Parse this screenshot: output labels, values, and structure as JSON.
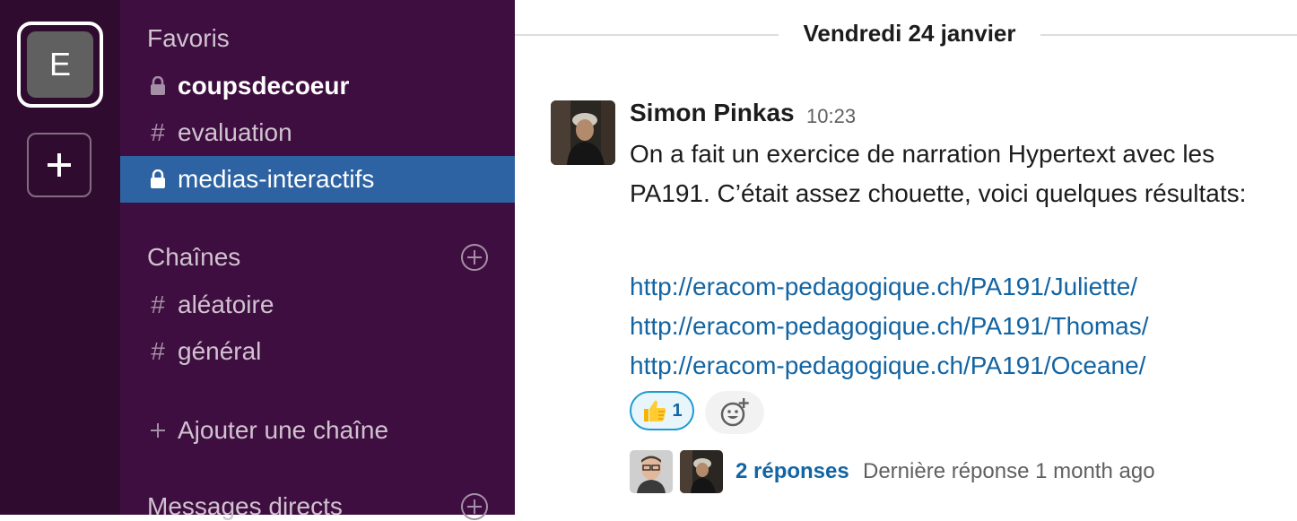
{
  "workspace": {
    "initial": "E"
  },
  "sidebar": {
    "favorites": {
      "title": "Favoris",
      "channels": [
        {
          "prefix": "lock",
          "name": "coupsdecoeur",
          "state": "unread"
        },
        {
          "prefix": "#",
          "name": "evaluation",
          "state": "normal"
        },
        {
          "prefix": "lock",
          "name": "medias-interactifs",
          "state": "active"
        }
      ]
    },
    "channels": {
      "title": "Chaînes",
      "items": [
        {
          "prefix": "#",
          "name": "aléatoire"
        },
        {
          "prefix": "#",
          "name": "général"
        }
      ],
      "add_label": "Ajouter une chaîne"
    },
    "direct_messages": {
      "title": "Messages directs"
    }
  },
  "main": {
    "date_divider": "Vendredi 24 janvier",
    "message": {
      "author": "Simon Pinkas",
      "time": "10:23",
      "text": "On a fait un exercice de narration Hypertext avec les PA191. C’était assez chouette, voici quelques résultats:",
      "links": [
        "http://eracom-pedagogique.ch/PA191/Juliette/",
        "http://eracom-pedagogique.ch/PA191/Thomas/",
        "http://eracom-pedagogique.ch/PA191/Oceane/"
      ],
      "reaction": {
        "emoji": "thumbs-up-icon",
        "count": "1"
      },
      "thread": {
        "replies_label": "2 réponses",
        "last_reply": "Dernière réponse 1 month ago"
      }
    }
  },
  "colors": {
    "rail_bg": "#2f0c2f",
    "sidebar_bg": "#3f0e40",
    "active_channel": "#2d63a2",
    "link": "#1264a3"
  }
}
